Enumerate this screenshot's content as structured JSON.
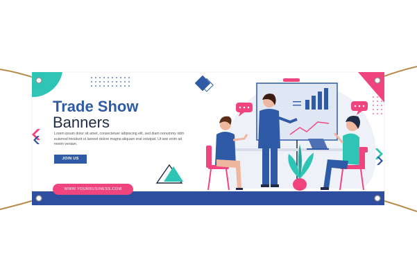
{
  "banner": {
    "title_line1": "Trade Show",
    "title_line2": "Banners",
    "body_text": "Lorem ipsum dolor sit amet, consectetuer adipiscing elit, sed diam nonummy nibh euismod tincidunt ut laoreet dolore magna aliquam erat volutpat. Ut wisi enim ad minim veniam.",
    "cta_label": "JOIN US",
    "website": "WWW.YOURBUSINESS.COM"
  },
  "colors": {
    "brand_blue": "#2f5aa5",
    "accent_pink": "#f0447f",
    "accent_teal": "#2ec4b6",
    "footer_blue": "#2e4fa0"
  },
  "icons": [
    "grommet-icon",
    "rope-icon",
    "speech-bubble-icon",
    "chart-board-icon",
    "laptop-icon",
    "plant-icon"
  ]
}
